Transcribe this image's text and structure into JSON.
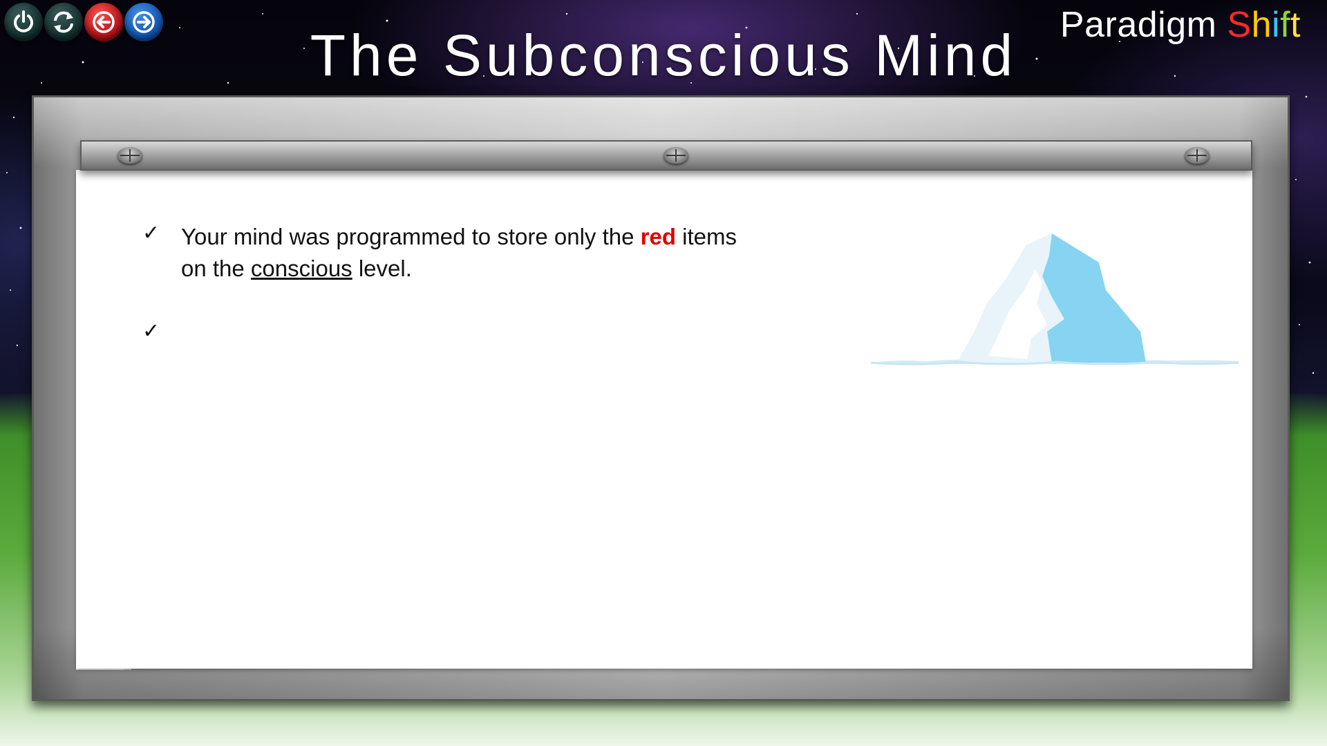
{
  "nav": {
    "power_icon": "power-icon",
    "refresh_icon": "refresh-icon",
    "back_icon": "arrow-left-icon",
    "forward_icon": "arrow-right-icon"
  },
  "brand": {
    "word1": "Paradigm",
    "s": "S",
    "h": "h",
    "i": "i",
    "f": "f",
    "t": "t",
    "colors": [
      "#ff2a2a",
      "#ffcc00",
      "#2ec8ff",
      "#8fd63d",
      "#ffe14a"
    ]
  },
  "title": "The Subconscious Mind",
  "content": {
    "bullet_mark": "✓",
    "line1_a": "Your mind was programmed to store only the",
    "line1_red": "red",
    "line1_b": "items",
    "line2_a": "on the",
    "line2_underlined": "conscious",
    "line2_b": "level.",
    "accent_color": "#e00000"
  },
  "image": {
    "iceberg_icon": "iceberg-illustration"
  }
}
